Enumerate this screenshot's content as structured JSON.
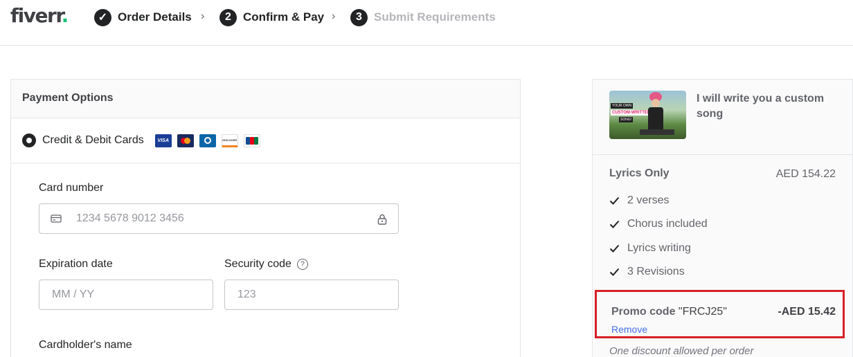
{
  "header": {
    "logo": "fiverr",
    "logo_dot": ".",
    "steps": [
      {
        "number": "✓",
        "label": "Order Details",
        "state": "done"
      },
      {
        "number": "2",
        "label": "Confirm & Pay",
        "state": "current"
      },
      {
        "number": "3",
        "label": "Submit Requirements",
        "state": "future"
      }
    ],
    "chevron": "›"
  },
  "payment": {
    "title": "Payment Options",
    "option_label": "Credit & Debit Cards",
    "card_brands": [
      "visa-icon",
      "mastercard-icon",
      "diners-icon",
      "discover-icon",
      "jcb-icon"
    ],
    "visa_text": "VISA",
    "discover_text": "DISCOVER",
    "card_number_label": "Card number",
    "card_number_placeholder": "1234 5678 9012 3456",
    "expiry_label": "Expiration date",
    "expiry_placeholder": "MM / YY",
    "security_label": "Security code",
    "security_help": "?",
    "security_placeholder": "123",
    "cardholder_label": "Cardholder's name"
  },
  "summary": {
    "gig_title": "I will write you a custom song",
    "thumb_lines": [
      "YOUR OWN",
      "CUSTOM-WRITTEN",
      "SONG!"
    ],
    "package_name": "Lyrics Only",
    "package_price": "AED 154.22",
    "features": [
      "2 verses",
      "Chorus included",
      "Lyrics writing",
      "3 Revisions"
    ],
    "promo_prefix": "Promo code",
    "promo_code": "\"FRCJ25\"",
    "promo_amount": "-AED 15.42",
    "remove_label": "Remove",
    "discount_note": "One discount allowed per order"
  },
  "colors": {
    "brand_green": "#1dbf73",
    "highlight_red": "#d81f26",
    "link_blue": "#446ee7"
  }
}
